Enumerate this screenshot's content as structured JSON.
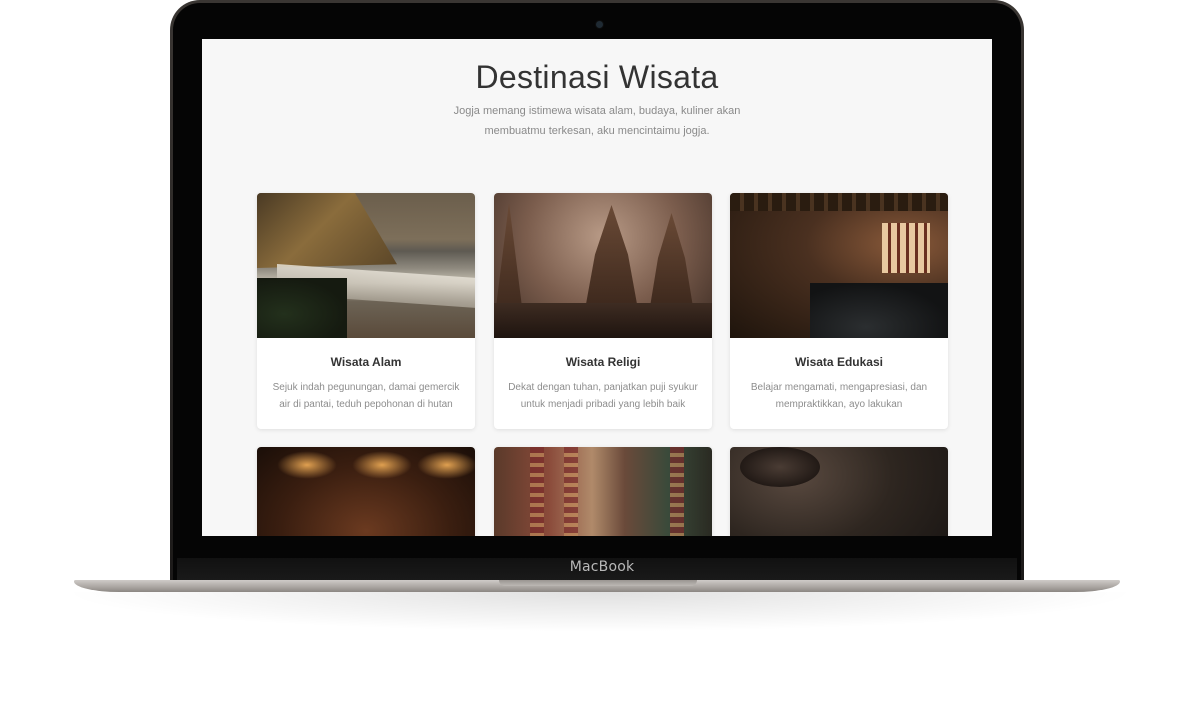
{
  "device": {
    "brand_label": "MacBook"
  },
  "page": {
    "title": "Destinasi Wisata",
    "subtitle": "Jogja memang istimewa wisata alam, budaya, kuliner akan membuatmu terkesan, aku mencintaimu jogja."
  },
  "cards": [
    {
      "title": "Wisata Alam",
      "description": "Sejuk indah pegunungan, damai gemercik air di pantai, teduh pepohonan di hutan",
      "image": "beach-photo"
    },
    {
      "title": "Wisata Religi",
      "description": "Dekat dengan tuhan, panjatkan puji syukur untuk menjadi pribadi yang lebih baik",
      "image": "temple-photo"
    },
    {
      "title": "Wisata Edukasi",
      "description": "Belajar mengamati, mengapresiasi, dan mempraktikkan, ayo lakukan",
      "image": "classroom-photo"
    },
    {
      "title": "",
      "description": "",
      "image": "gamelan-photo"
    },
    {
      "title": "",
      "description": "",
      "image": "batik-market-photo"
    },
    {
      "title": "",
      "description": "",
      "image": "traditional-food-photo"
    }
  ]
}
